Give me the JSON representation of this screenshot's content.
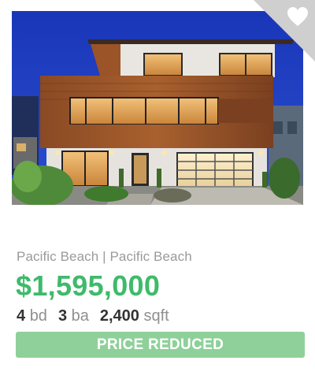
{
  "listing": {
    "location": "Pacific Beach | Pacific Beach",
    "price": "$1,595,000",
    "beds": "4",
    "beds_unit": "bd",
    "baths": "3",
    "baths_unit": "ba",
    "sqft": "2,400",
    "sqft_unit": "sqft",
    "badge": "PRICE REDUCED",
    "favorite_icon": "heart-icon"
  },
  "colors": {
    "price": "#3fba6b",
    "badge_bg": "#8fd09a",
    "location": "#9a9a9a",
    "corner_bg": "#cfcfcf"
  }
}
